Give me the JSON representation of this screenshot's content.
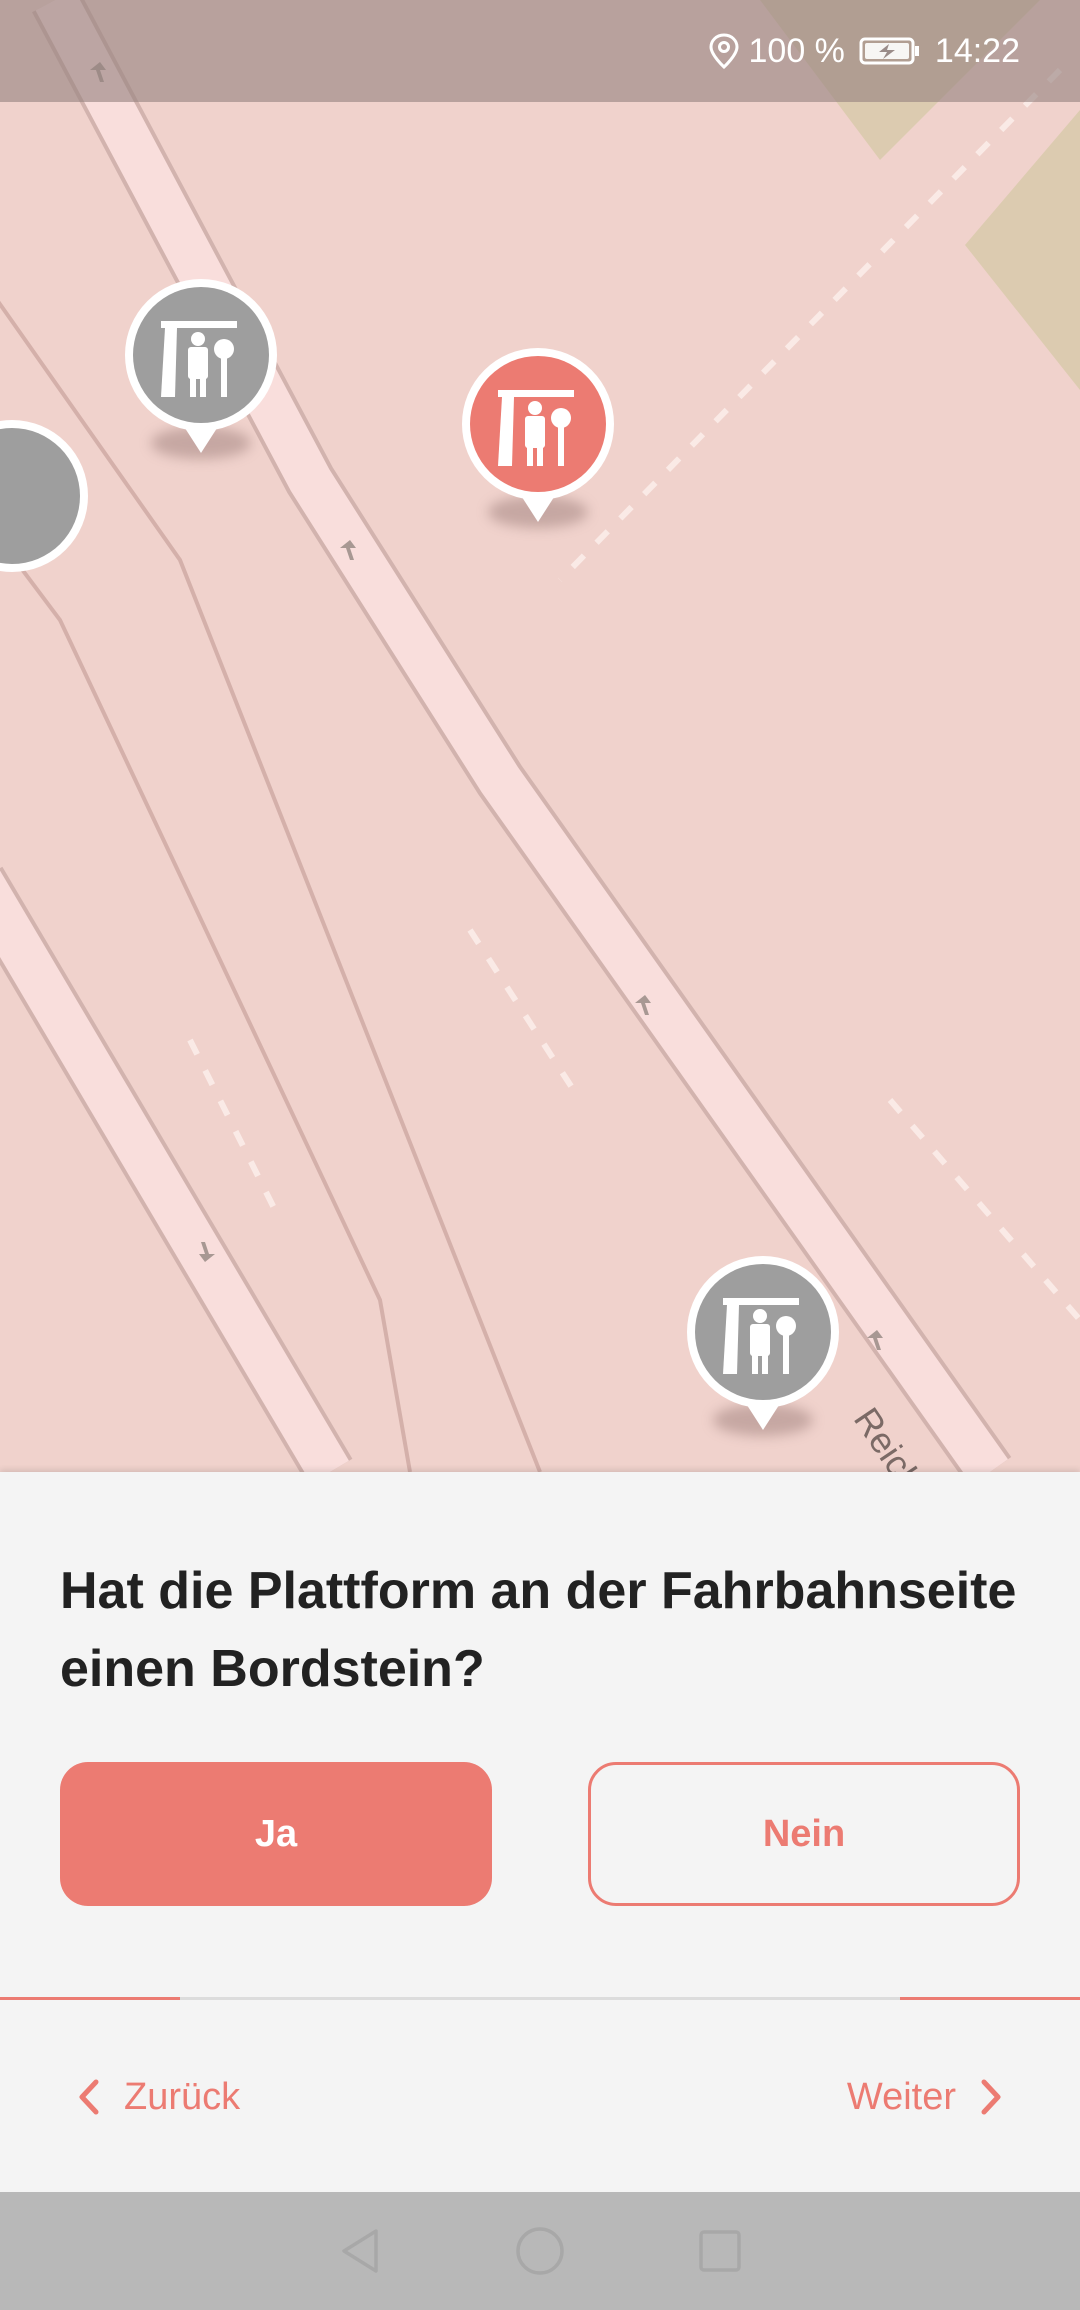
{
  "status_bar": {
    "battery_percent": "100 %",
    "time": "14:22",
    "icons": [
      "location-pin-icon",
      "battery-charging-icon"
    ]
  },
  "map": {
    "street_label": "Reiche",
    "markers": [
      {
        "name": "bus-stop-marker",
        "state": "inactive",
        "color": "#9e9e9e"
      },
      {
        "name": "bus-stop-marker-selected",
        "state": "selected",
        "color": "#ec7b72"
      },
      {
        "name": "bus-stop-marker",
        "state": "inactive",
        "color": "#9e9e9e"
      },
      {
        "name": "bus-stop-marker-partial",
        "state": "inactive",
        "color": "#9e9e9e"
      }
    ]
  },
  "quest": {
    "question": "Hat die Plattform an der Fahrbahnseite einen Bordstein?",
    "yes_label": "Ja",
    "no_label": "Nein"
  },
  "navigation": {
    "back_label": "Zurück",
    "next_label": "Weiter"
  },
  "system_nav": {
    "icons": [
      "back-triangle-icon",
      "home-circle-icon",
      "recents-square-icon"
    ]
  },
  "colors": {
    "accent": "#ec7b72",
    "map_background": "#f0d2cc",
    "road": "#f9dedc",
    "marker_inactive": "#9e9e9e"
  }
}
